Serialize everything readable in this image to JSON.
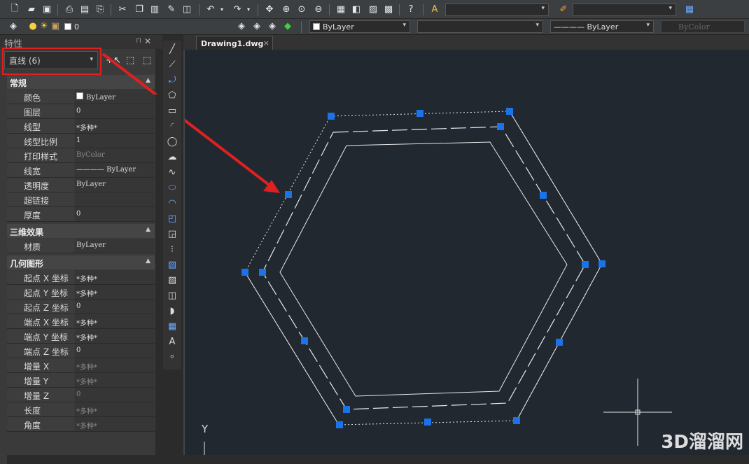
{
  "toolbar": {
    "layer_value": "0",
    "color_value": "ByLayer",
    "linetype_value": "",
    "lineweight_value": "———— ByLayer",
    "plotstyle_value": "ByColor"
  },
  "properties": {
    "title": "特性",
    "selection": "直线 (6)",
    "sections": [
      {
        "name": "常规",
        "rows": [
          {
            "label": "颜色",
            "value": "ByLayer",
            "swatch": true
          },
          {
            "label": "图层",
            "value": "0"
          },
          {
            "label": "线型",
            "value": "*多种*"
          },
          {
            "label": "线型比例",
            "value": "1"
          },
          {
            "label": "打印样式",
            "value": "ByColor",
            "dim": true
          },
          {
            "label": "线宽",
            "value": "———— ByLayer"
          },
          {
            "label": "透明度",
            "value": "ByLayer"
          },
          {
            "label": "超链接",
            "value": ""
          },
          {
            "label": "厚度",
            "value": "0"
          }
        ]
      },
      {
        "name": "三维效果",
        "rows": [
          {
            "label": "材质",
            "value": "ByLayer"
          }
        ]
      },
      {
        "name": "几何图形",
        "rows": [
          {
            "label": "起点 X 坐标",
            "value": "*多种*"
          },
          {
            "label": "起点 Y 坐标",
            "value": "*多种*"
          },
          {
            "label": "起点 Z 坐标",
            "value": "0"
          },
          {
            "label": "端点 X 坐标",
            "value": "*多种*"
          },
          {
            "label": "端点 Y 坐标",
            "value": "*多种*"
          },
          {
            "label": "端点 Z 坐标",
            "value": "0"
          },
          {
            "label": "增量 X",
            "value": "*多种*",
            "dim": true
          },
          {
            "label": "增量 Y",
            "value": "*多种*",
            "dim": true
          },
          {
            "label": "增量 Z",
            "value": "0",
            "dim": true
          },
          {
            "label": "长度",
            "value": "*多种*",
            "dim": true
          },
          {
            "label": "角度",
            "value": "*多种*",
            "dim": true
          }
        ]
      }
    ]
  },
  "drawing": {
    "tab_label": "Drawing1.dwg",
    "tab_close": "×",
    "ucs_label": "Y"
  },
  "watermark": "3D溜溜网",
  "colors": {
    "grip": "#1a73e8",
    "annotation": "#e02020",
    "canvas": "#212830"
  }
}
